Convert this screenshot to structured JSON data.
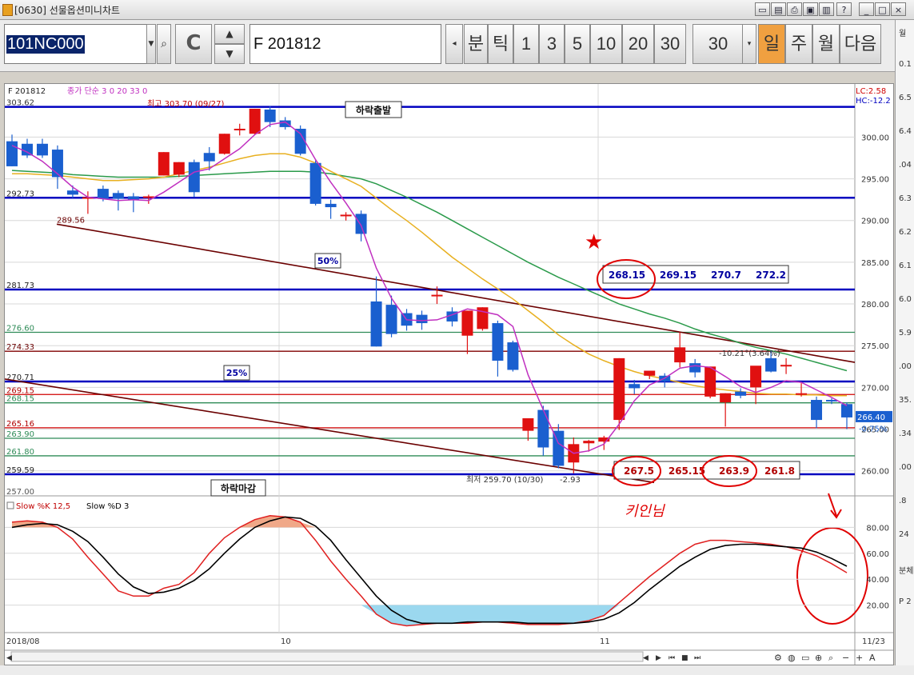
{
  "window": {
    "title": "[0630] 선물옵션미니차트"
  },
  "toolbar": {
    "code": "101NC000",
    "contract_name": "F  201812",
    "period_buttons": [
      "분",
      "틱",
      "1",
      "3",
      "5",
      "10",
      "20",
      "30"
    ],
    "period_value": "30",
    "range_buttons": [
      "일",
      "주",
      "월",
      "다음"
    ],
    "active_range": "일",
    "c_button": "C"
  },
  "chart": {
    "legend_contract": "F 201812",
    "legend_ma": "종가 단순 3  0  20  33  0",
    "lc_label": "LC:2.58",
    "hc_label": "HC:-12.2",
    "high_note": "최고 303.70 (09/27)",
    "low_note": "최저 259.70 (10/30)",
    "low_note_pct": "-2.93",
    "change_note": "-10.21°(3.64%)",
    "last_price": "266.40",
    "last_change": "-0.75%",
    "level_labels": [
      "303.62",
      "292.73",
      "289.56",
      "281.73",
      "276.60",
      "274.33",
      "270.71",
      "269.15",
      "268.15",
      "265.16",
      "263.90",
      "261.80",
      "259.59",
      "257.00"
    ],
    "price_axis": [
      "300.00",
      "295.00",
      "290.00",
      "285.00",
      "280.00",
      "275.00",
      "270.00",
      "265.00",
      "260.00"
    ],
    "boxes": {
      "start": "하락출발",
      "end": "하락마감",
      "half": "50%",
      "quarter": "25%"
    },
    "targets_upper": [
      "268.15",
      "269.15",
      "270.7",
      "272.2"
    ],
    "targets_lower": [
      "267.5",
      "265.15",
      "263.9",
      "261.8"
    ],
    "annotation_star": "★",
    "annotation_hand": "키인님",
    "stoch_legend_k": "Slow %K 12,5",
    "stoch_legend_d": "Slow %D 3",
    "stoch_axis": [
      "80.00",
      "60.00",
      "40.00",
      "20.00"
    ],
    "date_axis": [
      "2018/08",
      "10",
      "11",
      "11/23"
    ]
  },
  "right_panel": [
    "월",
    "0.1",
    "6.5",
    "6.4",
    ".04",
    "6.3",
    "6.2",
    "6.1",
    "6.0",
    "5.9",
    ".00",
    "35.",
    ".34",
    ".00",
    ".8",
    "24",
    "분체",
    "P 2"
  ],
  "chart_data": {
    "type": "candlestick",
    "candles": [
      {
        "o": 299.5,
        "h": 300.3,
        "c": 296.5,
        "l": 296.5
      },
      {
        "o": 299.2,
        "h": 299.8,
        "c": 297.8,
        "l": 297.5
      },
      {
        "o": 299.2,
        "h": 299.8,
        "c": 297.8,
        "l": 297.5
      },
      {
        "o": 298.5,
        "h": 299.0,
        "c": 295.2,
        "l": 293.8
      },
      {
        "o": 293.6,
        "h": 294.2,
        "c": 293.1,
        "l": 292.7
      },
      {
        "o": 292.8,
        "h": 293.5,
        "c": 292.8,
        "l": 290.8
      },
      {
        "o": 293.8,
        "h": 294.2,
        "c": 292.6,
        "l": 292.3
      },
      {
        "o": 293.3,
        "h": 293.6,
        "c": 292.6,
        "l": 291.2
      },
      {
        "o": 292.9,
        "h": 293.3,
        "c": 292.5,
        "l": 291.0
      },
      {
        "o": 292.9,
        "h": 293.1,
        "c": 292.9,
        "l": 292.0
      },
      {
        "o": 295.4,
        "h": 298.2,
        "c": 298.2,
        "l": 295.4
      },
      {
        "o": 295.5,
        "h": 297.0,
        "c": 297.0,
        "l": 295.2
      },
      {
        "o": 297.0,
        "h": 297.3,
        "c": 293.4,
        "l": 292.8
      },
      {
        "o": 298.1,
        "h": 298.8,
        "c": 297.1,
        "l": 296.0
      },
      {
        "o": 298.0,
        "h": 300.4,
        "c": 300.4,
        "l": 297.9
      },
      {
        "o": 301.0,
        "h": 301.6,
        "c": 301.0,
        "l": 300.2
      },
      {
        "o": 300.4,
        "h": 303.4,
        "c": 303.4,
        "l": 300.3
      },
      {
        "o": 303.3,
        "h": 303.7,
        "c": 301.8,
        "l": 301.2
      },
      {
        "o": 302.0,
        "h": 302.4,
        "c": 301.2,
        "l": 300.9
      },
      {
        "o": 301.0,
        "h": 301.4,
        "c": 298.0,
        "l": 297.8
      },
      {
        "o": 296.9,
        "h": 297.2,
        "c": 292.0,
        "l": 291.8
      },
      {
        "o": 292.0,
        "h": 292.5,
        "c": 291.6,
        "l": 290.2
      },
      {
        "o": 290.7,
        "h": 291.0,
        "c": 290.7,
        "l": 290.0
      },
      {
        "o": 290.8,
        "h": 291.2,
        "c": 288.4,
        "l": 287.5
      },
      {
        "o": 280.3,
        "h": 283.3,
        "c": 274.9,
        "l": 274.9
      },
      {
        "o": 279.9,
        "h": 281.0,
        "c": 276.4,
        "l": 276.0
      },
      {
        "o": 278.9,
        "h": 279.4,
        "c": 277.4,
        "l": 276.8
      },
      {
        "o": 278.7,
        "h": 279.2,
        "c": 277.7,
        "l": 276.9
      },
      {
        "o": 281.1,
        "h": 282.1,
        "c": 281.1,
        "l": 280.0
      },
      {
        "o": 279.1,
        "h": 279.6,
        "c": 277.9,
        "l": 277.3
      },
      {
        "o": 276.2,
        "h": 279.2,
        "c": 279.2,
        "l": 274.0
      },
      {
        "o": 277.0,
        "h": 279.6,
        "c": 279.6,
        "l": 276.8
      },
      {
        "o": 277.7,
        "h": 278.0,
        "c": 273.2,
        "l": 271.3
      },
      {
        "o": 275.4,
        "h": 275.6,
        "c": 272.1,
        "l": 271.9
      },
      {
        "o": 264.8,
        "h": 266.3,
        "c": 266.3,
        "l": 263.6
      },
      {
        "o": 267.3,
        "h": 267.8,
        "c": 262.8,
        "l": 261.8
      },
      {
        "o": 264.8,
        "h": 265.6,
        "c": 260.6,
        "l": 260.3
      },
      {
        "o": 261.0,
        "h": 264.0,
        "c": 263.2,
        "l": 259.7
      },
      {
        "o": 263.3,
        "h": 263.7,
        "c": 263.6,
        "l": 262.3
      },
      {
        "o": 263.5,
        "h": 264.2,
        "c": 264.0,
        "l": 262.5
      },
      {
        "o": 266.1,
        "h": 273.5,
        "c": 273.5,
        "l": 264.9
      },
      {
        "o": 270.4,
        "h": 270.9,
        "c": 269.9,
        "l": 269.2
      },
      {
        "o": 271.4,
        "h": 271.9,
        "c": 272.0,
        "l": 271.0
      },
      {
        "o": 271.4,
        "h": 271.7,
        "c": 270.7,
        "l": 270.0
      },
      {
        "o": 273.0,
        "h": 276.6,
        "c": 274.8,
        "l": 272.4
      },
      {
        "o": 272.9,
        "h": 273.4,
        "c": 271.8,
        "l": 271.2
      },
      {
        "o": 268.9,
        "h": 272.5,
        "c": 272.5,
        "l": 268.7
      },
      {
        "o": 268.2,
        "h": 269.3,
        "c": 269.3,
        "l": 265.3
      },
      {
        "o": 269.5,
        "h": 269.9,
        "c": 269.0,
        "l": 268.7
      },
      {
        "o": 270.0,
        "h": 270.0,
        "c": 272.6,
        "l": 268.0
      },
      {
        "o": 273.5,
        "h": 274.4,
        "c": 271.9,
        "l": 271.8
      },
      {
        "o": 272.7,
        "h": 273.5,
        "c": 272.7,
        "l": 271.6
      },
      {
        "o": 269.3,
        "h": 270.5,
        "c": 269.3,
        "l": 268.9
      },
      {
        "o": 268.5,
        "h": 268.9,
        "c": 266.1,
        "l": 265.1
      },
      {
        "o": 268.5,
        "h": 268.7,
        "c": 268.4,
        "l": 268.0
      },
      {
        "o": 268.0,
        "h": 268.2,
        "c": 266.4,
        "l": 265.0
      }
    ],
    "ma_short": [
      299.0,
      298.2,
      297.1,
      295.6,
      294.0,
      292.8,
      292.6,
      292.4,
      292.5,
      292.4,
      293.4,
      294.6,
      295.8,
      296.2,
      297.4,
      298.6,
      300.3,
      301.5,
      301.8,
      300.4,
      297.3,
      294.6,
      292.1,
      289.4,
      284.3,
      280.7,
      278.1,
      278.0,
      278.1,
      278.7,
      279.4,
      279.1,
      278.7,
      277.3,
      271.5,
      267.3,
      263.3,
      262.1,
      262.4,
      263.2,
      265.6,
      268.4,
      270.3,
      271.1,
      272.3,
      272.6,
      272.4,
      271.3,
      270.1,
      269.4,
      270.0,
      270.8,
      270.6,
      269.7,
      268.8,
      267.8
    ],
    "ma_mid": [
      295.6,
      295.6,
      295.5,
      295.4,
      295.2,
      295.0,
      294.8,
      294.8,
      294.9,
      295.0,
      295.2,
      295.6,
      296.0,
      296.4,
      296.9,
      297.4,
      297.8,
      298.0,
      298.0,
      297.6,
      296.9,
      295.9,
      295.0,
      294.1,
      292.7,
      291.3,
      290.0,
      288.6,
      287.1,
      285.6,
      284.3,
      283.0,
      281.8,
      280.6,
      279.2,
      277.8,
      276.3,
      275.1,
      274.0,
      273.2,
      272.5,
      271.9,
      271.4,
      271.0,
      270.6,
      270.2,
      269.9,
      269.7,
      269.5,
      269.3,
      269.2,
      269.2,
      269.1,
      269.1,
      269.0,
      269.0
    ],
    "ma_long": [
      296.0,
      295.9,
      295.8,
      295.7,
      295.5,
      295.4,
      295.3,
      295.2,
      295.2,
      295.2,
      295.2,
      295.3,
      295.4,
      295.5,
      295.6,
      295.7,
      295.8,
      295.9,
      295.9,
      295.9,
      295.8,
      295.6,
      295.3,
      295.0,
      294.4,
      293.6,
      292.8,
      291.9,
      291.0,
      290.0,
      289.0,
      288.0,
      287.0,
      286.0,
      285.0,
      284.1,
      283.2,
      282.4,
      281.6,
      280.8,
      280.0,
      279.4,
      278.8,
      278.3,
      277.7,
      277.0,
      276.4,
      275.9,
      275.3,
      274.8,
      274.4,
      274.0,
      273.5,
      273.0,
      272.5,
      272.0
    ],
    "stoch_k": [
      84,
      85,
      84,
      80,
      71,
      57,
      44,
      31,
      27,
      27,
      33,
      36,
      45,
      60,
      72,
      80,
      86,
      89,
      88,
      84,
      70,
      54,
      40,
      27,
      13,
      6,
      4,
      5,
      6,
      6,
      6,
      7,
      7,
      6,
      5,
      5,
      5,
      6,
      8,
      12,
      22,
      32,
      42,
      51,
      60,
      67,
      70,
      70,
      69,
      68,
      67,
      65,
      62,
      58,
      52,
      45
    ],
    "stoch_d": [
      80,
      82,
      83,
      82,
      77,
      69,
      57,
      44,
      34,
      29,
      30,
      33,
      39,
      48,
      60,
      71,
      80,
      85,
      88,
      87,
      81,
      70,
      55,
      41,
      27,
      16,
      9,
      6,
      6,
      6,
      7,
      7,
      7,
      7,
      6,
      6,
      6,
      6,
      7,
      9,
      14,
      22,
      32,
      41,
      50,
      57,
      63,
      66,
      67,
      67,
      66,
      65,
      64,
      61,
      56,
      50
    ],
    "horizontal_levels": [
      {
        "v": 303.62,
        "color": "#0000c0"
      },
      {
        "v": 292.73,
        "color": "#0000c0"
      },
      {
        "v": 281.73,
        "color": "#0000c0"
      },
      {
        "v": 276.6,
        "color": "#2e8b57"
      },
      {
        "v": 274.33,
        "color": "#800000"
      },
      {
        "v": 270.71,
        "color": "#0000c0"
      },
      {
        "v": 269.15,
        "color": "#d00000"
      },
      {
        "v": 268.15,
        "color": "#2e8b57"
      },
      {
        "v": 265.16,
        "color": "#d00000"
      },
      {
        "v": 263.9,
        "color": "#2e8b57"
      },
      {
        "v": 261.8,
        "color": "#2e8b57"
      },
      {
        "v": 259.59,
        "color": "#0000c0"
      }
    ],
    "y_range": [
      257.0,
      305.6
    ],
    "stoch_range": [
      0,
      100
    ],
    "colors": {
      "up": "#e01010",
      "down": "#1a5fcf",
      "ma_short": "#c030c0",
      "ma_mid": "#e8b020",
      "ma_long": "#2a9a4a",
      "stoch_k": "#e02020",
      "stoch_d": "#000000"
    }
  }
}
